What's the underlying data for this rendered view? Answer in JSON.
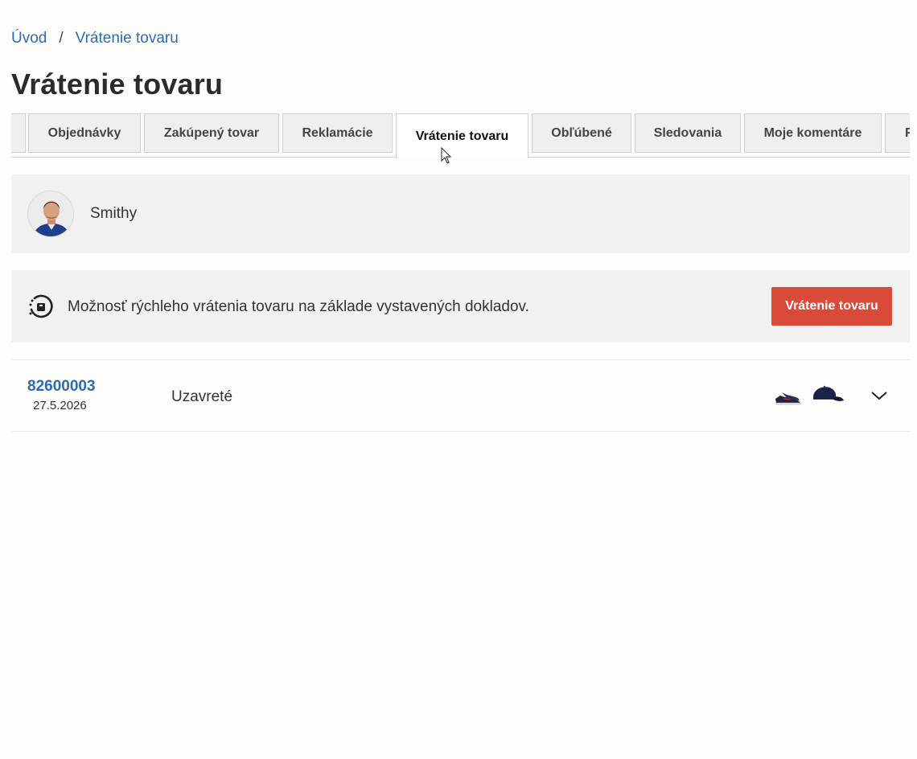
{
  "breadcrumb": {
    "home": "Úvod",
    "separator": "/",
    "current": "Vrátenie tovaru"
  },
  "page_title": "Vrátenie tovaru",
  "tabs": [
    {
      "label": ""
    },
    {
      "label": "Objednávky"
    },
    {
      "label": "Zakúpený tovar"
    },
    {
      "label": "Reklamácie"
    },
    {
      "label": "Vrátenie tovaru",
      "active": true
    },
    {
      "label": "Obľúbené"
    },
    {
      "label": "Sledovania"
    },
    {
      "label": "Moje komentáre"
    },
    {
      "label": "F"
    }
  ],
  "user": {
    "name": "Smithy"
  },
  "quick_return": {
    "icon": "return-clock-icon",
    "text": "Možnosť rýchleho vrátenia tovaru na základe vystavených dokladov.",
    "button_label": "Vrátenie tovaru",
    "button_color": "#d94a38"
  },
  "documents": [
    {
      "number": "82600003",
      "date": "27.5.2026",
      "status": "Uzavreté",
      "thumbnails": [
        "shoe-thumbnail",
        "cap-thumbnail"
      ]
    }
  ],
  "colors": {
    "link": "#2a6bb3",
    "panel_bg": "#f1f1f1"
  }
}
